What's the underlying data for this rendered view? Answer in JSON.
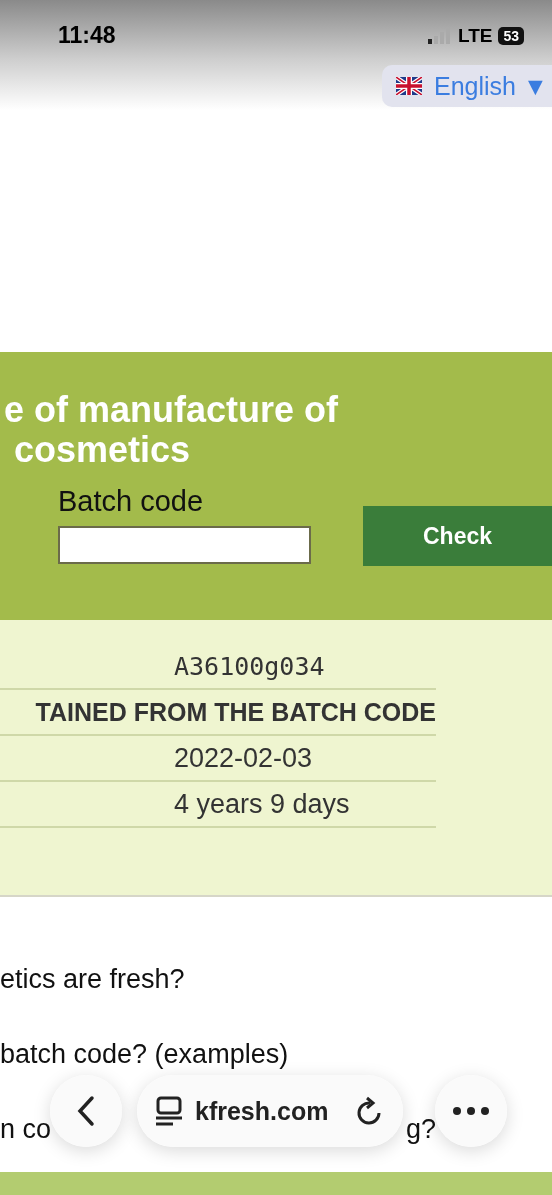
{
  "status_bar": {
    "time": "11:48",
    "network": "LTE",
    "battery": "53"
  },
  "language": {
    "label": "English",
    "arrow": "▼"
  },
  "hero": {
    "title_lines": [
      "e of manufacture of",
      "cosmetics"
    ],
    "field_label": "Batch code",
    "button": "Check"
  },
  "result": {
    "rows": [
      {
        "kind": "code",
        "text": "A36100g034"
      },
      {
        "kind": "header",
        "text": "TAINED FROM THE BATCH CODE"
      },
      {
        "kind": "value",
        "text": "2022-02-03"
      },
      {
        "kind": "value",
        "text": "4 years 9 days"
      }
    ]
  },
  "links": [
    {
      "text": "etics are fresh?"
    },
    {
      "text": "batch code? (examples)"
    },
    {
      "text": "n co",
      "tail": "g?"
    }
  ],
  "browser_bar": {
    "url": "kfresh.com"
  }
}
